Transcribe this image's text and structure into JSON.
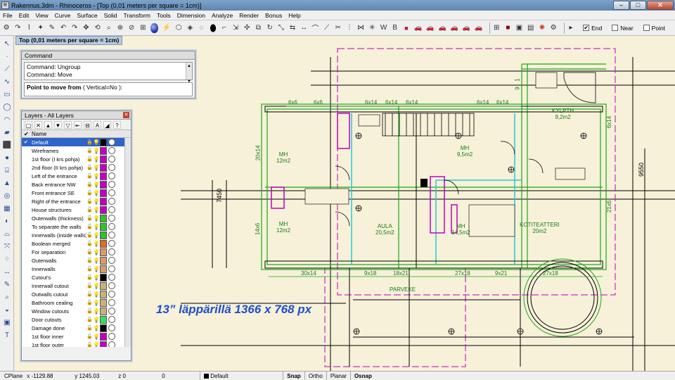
{
  "window": {
    "title": "Rakennus.3dm - Rhinoceros - [Top (0,01 meters per square = 1cm)]",
    "buttons": [
      "–",
      "□",
      "✕"
    ]
  },
  "menu": [
    "File",
    "Edit",
    "View",
    "Curve",
    "Surface",
    "Solid",
    "Transform",
    "Tools",
    "Dimension",
    "Analyze",
    "Render",
    "Bonus",
    "Help"
  ],
  "osnap": {
    "end_label": "End",
    "end_checked": true,
    "near_label": "Near",
    "near_checked": false,
    "point_label": "Point",
    "point_checked": false
  },
  "viewport": {
    "title": "Top (0,01 meters per square = 1cm)",
    "overlay": "13” läppärillä 1366 x 768 px",
    "dims": {
      "top": [
        "6x6",
        "6x6",
        "6x14",
        "6x14",
        "6x14",
        "6x14",
        "6x14"
      ],
      "bottom": [
        "30x14",
        "9x18",
        "18x21",
        "27x18",
        "9x21",
        "27x18"
      ],
      "right_vertical": [
        "6x14",
        "21x6"
      ],
      "left_vertical": [
        "20x14",
        "14x6",
        "7450"
      ],
      "overall": "9550",
      "top_small": [
        "1",
        "9"
      ]
    },
    "rooms": [
      {
        "name": "MH",
        "area": "12m2"
      },
      {
        "name": "MH",
        "area": "9,5m2"
      },
      {
        "name": "KYLPTH",
        "area": "9,2m2"
      },
      {
        "name": "MH",
        "area": "12m2"
      },
      {
        "name": "AULA",
        "area": "20,5m2"
      },
      {
        "name": "MH",
        "area": "14,5m2"
      },
      {
        "name": "KOTITEATTERI",
        "area": "20m2"
      },
      {
        "name": "PARVEKE",
        "area": ""
      }
    ]
  },
  "command": {
    "title": "Command",
    "history": [
      "Command: Ungroup",
      "Command: Move"
    ],
    "prompt_bold": "Point to move from",
    "prompt_rest": "( Vertical=No ):"
  },
  "layers": {
    "title": "Layers - All Layers",
    "header": "Name",
    "rows": [
      {
        "name": "Default",
        "color": "#000000",
        "current": true,
        "locked": false
      },
      {
        "name": "Wireframes",
        "color": "#c000c0",
        "locked": false
      },
      {
        "name": "1st floor (I krs pohja)",
        "color": "#c000c0",
        "locked": false
      },
      {
        "name": "2nd floor (II krs pohja)",
        "color": "#c000c0",
        "locked": false
      },
      {
        "name": "Left of the entrance",
        "color": "#c000c0",
        "locked": false
      },
      {
        "name": "Back entrance NW",
        "color": "#c000c0",
        "locked": true
      },
      {
        "name": "Front entrance SE",
        "color": "#c000c0",
        "locked": false
      },
      {
        "name": "Right of the entrance",
        "color": "#c000c0",
        "locked": false
      },
      {
        "name": "House structures",
        "color": "#c000c0",
        "locked": false
      },
      {
        "name": "Outerwalls (thickness)",
        "color": "#30c030",
        "locked": false
      },
      {
        "name": "To separate the walls",
        "color": "#30c030",
        "locked": false
      },
      {
        "name": "Innerwalls (inside walls)",
        "color": "#30c030",
        "locked": false
      },
      {
        "name": "Boolean merged",
        "color": "#e06a20",
        "locked": false
      },
      {
        "name": "For separation",
        "color": "#d99a6c",
        "locked": false
      },
      {
        "name": "Outerwalls",
        "color": "#d99a6c",
        "locked": false
      },
      {
        "name": "Innerwalls",
        "color": "#d99a6c",
        "locked": false
      },
      {
        "name": "Cutout's",
        "color": "#000000",
        "locked": false
      },
      {
        "name": "Innerwall cutout",
        "color": "#c8b27a",
        "locked": false
      },
      {
        "name": "Outwalls cutout",
        "color": "#c8b27a",
        "locked": false
      },
      {
        "name": "Bathroom cealing",
        "color": "#c8b27a",
        "locked": false
      },
      {
        "name": "Window cutouts",
        "color": "#c8b27a",
        "locked": false
      },
      {
        "name": "Door cutouts",
        "color": "#30e060",
        "locked": false
      },
      {
        "name": "Damage done",
        "color": "#000000",
        "locked": false
      },
      {
        "name": "1st floor inner",
        "color": "#c000c0",
        "locked": false
      },
      {
        "name": "1st floor outer",
        "color": "#c000c0",
        "locked": false
      }
    ]
  },
  "status": {
    "cplane": "CPlane",
    "x": "x -1129.88",
    "y": "y 1245.03",
    "z": "z 0",
    "extra": "0",
    "layer": "Default",
    "snap": "Snap",
    "ortho": "Ortho",
    "planar": "Planar",
    "osnap": "Osnap"
  }
}
